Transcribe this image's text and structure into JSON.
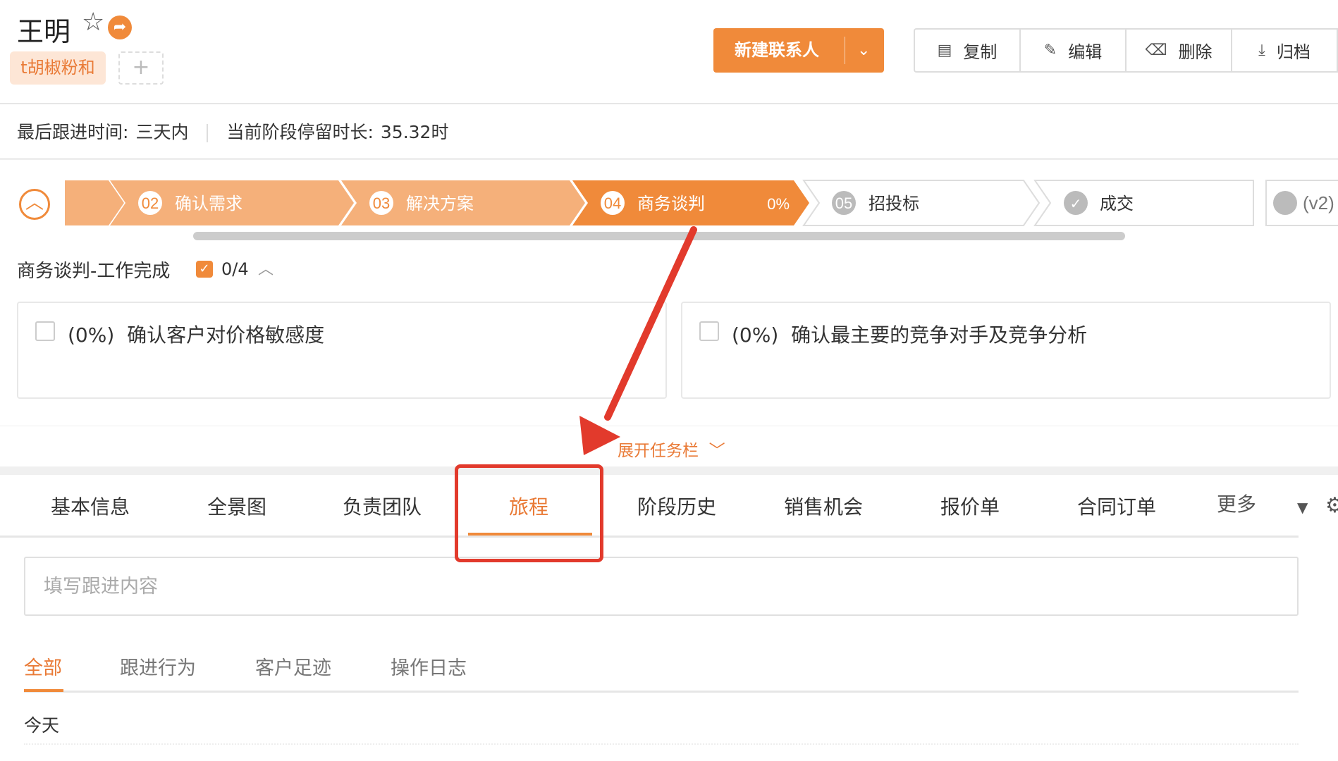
{
  "header": {
    "title": "王明",
    "tag": "t胡椒粉和",
    "add_tag_symbol": "+",
    "primary_button": "新建联系人",
    "actions": [
      {
        "label": "复制",
        "icon": "copy-icon",
        "glyph": "🗐"
      },
      {
        "label": "编辑",
        "icon": "edit-icon",
        "glyph": "✎"
      },
      {
        "label": "删除",
        "icon": "trash-icon",
        "glyph": "🗑"
      },
      {
        "label": "归档",
        "icon": "archive-icon",
        "glyph": "⤓"
      }
    ]
  },
  "meta": {
    "last_followup_label": "最后跟进时间:",
    "last_followup_value": "三天内",
    "stage_duration_label": "当前阶段停留时长:",
    "stage_duration_value": "35.32时"
  },
  "stages": [
    {
      "num": "",
      "label": "",
      "state": "done"
    },
    {
      "num": "02",
      "label": "确认需求",
      "state": "done"
    },
    {
      "num": "03",
      "label": "解决方案",
      "state": "done"
    },
    {
      "num": "04",
      "label": "商务谈判",
      "state": "current",
      "percent": "0%"
    },
    {
      "num": "05",
      "label": "招投标",
      "state": "pending"
    },
    {
      "num": "✓",
      "label": "成交",
      "state": "pending"
    },
    {
      "num": "",
      "label": "(v2)",
      "state": "pending"
    }
  ],
  "tasks": {
    "title": "商务谈判-工作完成",
    "count": "0/4",
    "items": [
      {
        "percent": "(0%)",
        "text": "确认客户对价格敏感度"
      },
      {
        "percent": "(0%)",
        "text": "确认最主要的竞争对手及竞争分析"
      }
    ],
    "expand_label": "展开任务栏"
  },
  "tabs": {
    "items": [
      "基本信息",
      "全景图",
      "负责团队",
      "旅程",
      "阶段历史",
      "销售机会",
      "报价单",
      "合同订单",
      "更多"
    ],
    "active": "旅程"
  },
  "followup": {
    "placeholder": "填写跟进内容"
  },
  "subtabs": {
    "items": [
      "全部",
      "跟进行为",
      "客户足迹",
      "操作日志"
    ],
    "active": "全部"
  },
  "timeline": {
    "group_label": "今天"
  },
  "colors": {
    "accent": "#f08a3a",
    "stage_done": "#f5b07a",
    "annotation_red": "#e23a2c"
  }
}
